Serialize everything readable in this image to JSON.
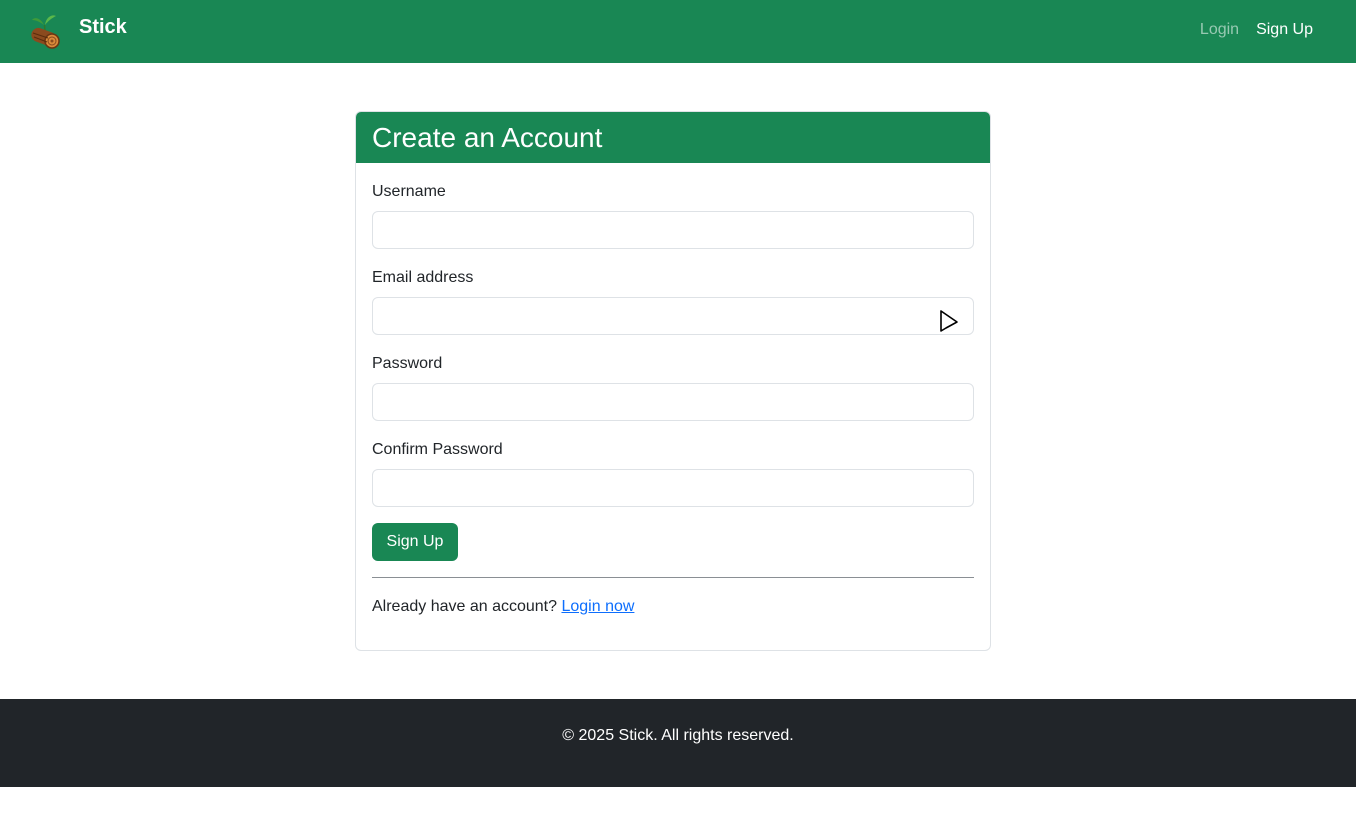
{
  "navbar": {
    "brand_name": "Stick",
    "logo_icon": "log-with-sprout-icon",
    "links": [
      {
        "label": "Login",
        "state": "inactive"
      },
      {
        "label": "Sign Up",
        "state": "active"
      }
    ],
    "bg_color": "#198754"
  },
  "form": {
    "title": "Create an Account",
    "fields": [
      {
        "label": "Username",
        "value": "",
        "placeholder": ""
      },
      {
        "label": "Email address",
        "value": "",
        "placeholder": ""
      },
      {
        "label": "Password",
        "value": "",
        "placeholder": ""
      },
      {
        "label": "Confirm Password",
        "value": "",
        "placeholder": ""
      }
    ],
    "submit_label": "Sign Up",
    "login_prompt": "Already have an account?",
    "login_link_label": "Login now"
  },
  "footer": {
    "text": "© 2025 Stick. All rights reserved."
  },
  "colors": {
    "accent": "#198754",
    "link": "#0d6efd",
    "footer_bg": "#212529"
  }
}
